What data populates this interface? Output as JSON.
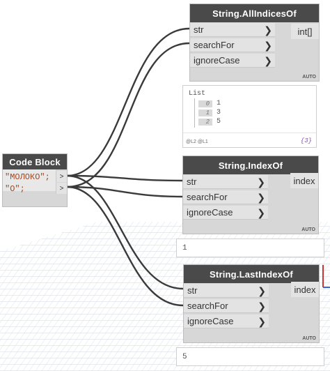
{
  "code_block": {
    "title": "Code Block",
    "lines": [
      "\"МОЛОКО\";",
      "\"О\";"
    ],
    "out_glyph": ">"
  },
  "nodes": {
    "all_indices": {
      "title": "String.AllIndicesOf",
      "inputs": [
        "str",
        "searchFor",
        "ignoreCase"
      ],
      "output": "int[]",
      "lacing": "AUTO"
    },
    "index_of": {
      "title": "String.IndexOf",
      "inputs": [
        "str",
        "searchFor",
        "ignoreCase"
      ],
      "output": "index",
      "lacing": "AUTO"
    },
    "last_index_of": {
      "title": "String.LastIndexOf",
      "inputs": [
        "str",
        "searchFor",
        "ignoreCase"
      ],
      "output": "index",
      "lacing": "AUTO"
    }
  },
  "chevron": "❯",
  "previews": {
    "all_indices": {
      "title": "List",
      "items": [
        {
          "index": "0",
          "value": "1"
        },
        {
          "index": "1",
          "value": "3"
        },
        {
          "index": "2",
          "value": "5"
        }
      ],
      "levels": "@L2 @L1",
      "count": "{3}"
    },
    "index_of": {
      "value": "1"
    },
    "last_index_of": {
      "value": "5"
    }
  },
  "colors": {
    "header": "#4a4a4a",
    "node_body": "#d7d7d7",
    "port": "#e3e3e3",
    "wire": "#3a3a3a",
    "code_text": "#a04a24",
    "count_text": "#8a4fb8"
  }
}
